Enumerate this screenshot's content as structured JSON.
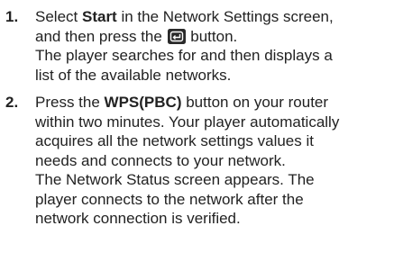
{
  "steps": [
    {
      "number": "1.",
      "line1_before": "Select ",
      "line1_bold": "Start",
      "line1_after": " in the Network Settings screen,",
      "line2_before": "and then press the ",
      "button_icon": "enter-button-icon",
      "line2_after": " button.",
      "line3": "The player searches for and then displays a",
      "line4": "list of the available networks."
    },
    {
      "number": "2.",
      "line1_before": "Press the ",
      "line1_bold": "WPS(PBC)",
      "line1_after": " button on your router",
      "line2": "within two minutes. Your player automatically",
      "line3": "acquires all the network settings values it",
      "line4": "needs and connects to your network.",
      "line5": "The Network Status screen appears. The",
      "line6": "player connects to the network after the",
      "line7": "network connection is verified."
    }
  ],
  "colors": {
    "text": "#222222",
    "button_bg": "#2a2a2a",
    "button_fg": "#ffffff"
  }
}
